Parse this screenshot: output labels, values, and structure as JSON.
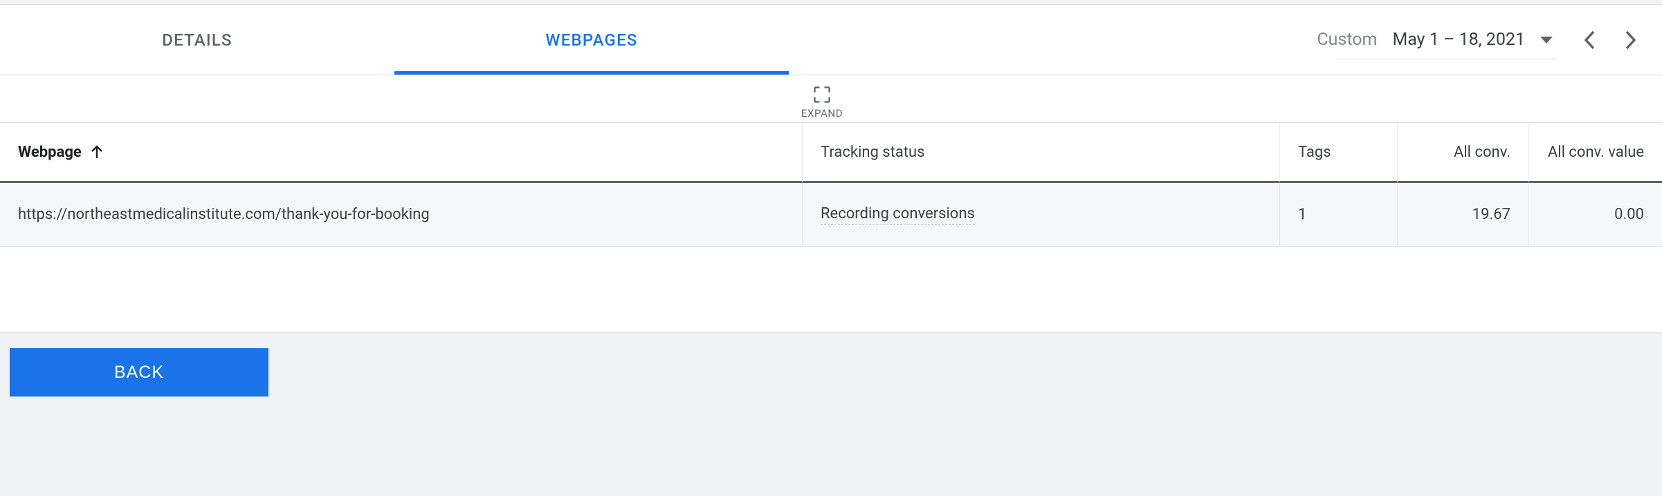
{
  "tabs": {
    "details": "DETAILS",
    "webpages": "WEBPAGES",
    "active": "webpages"
  },
  "dateRange": {
    "label": "Custom",
    "value": "May 1 – 18, 2021"
  },
  "expand": {
    "label": "EXPAND"
  },
  "table": {
    "headers": {
      "webpage": "Webpage",
      "tracking": "Tracking status",
      "tags": "Tags",
      "allconv": "All conv.",
      "allconvvalue": "All conv. value"
    },
    "rows": [
      {
        "webpage": "https://northeastmedicalinstitute.com/thank-you-for-booking",
        "tracking": "Recording conversions",
        "tags": "1",
        "allconv": "19.67",
        "allconvvalue": "0.00"
      }
    ]
  },
  "back": {
    "label": "BACK"
  },
  "chart_data": {
    "type": "table",
    "categories": [
      "Webpage",
      "Tracking status",
      "Tags",
      "All conv.",
      "All conv. value"
    ],
    "rows": [
      [
        "https://northeastmedicalinstitute.com/thank-you-for-booking",
        "Recording conversions",
        1,
        19.67,
        0.0
      ]
    ],
    "title": "",
    "xlabel": "",
    "ylabel": ""
  }
}
